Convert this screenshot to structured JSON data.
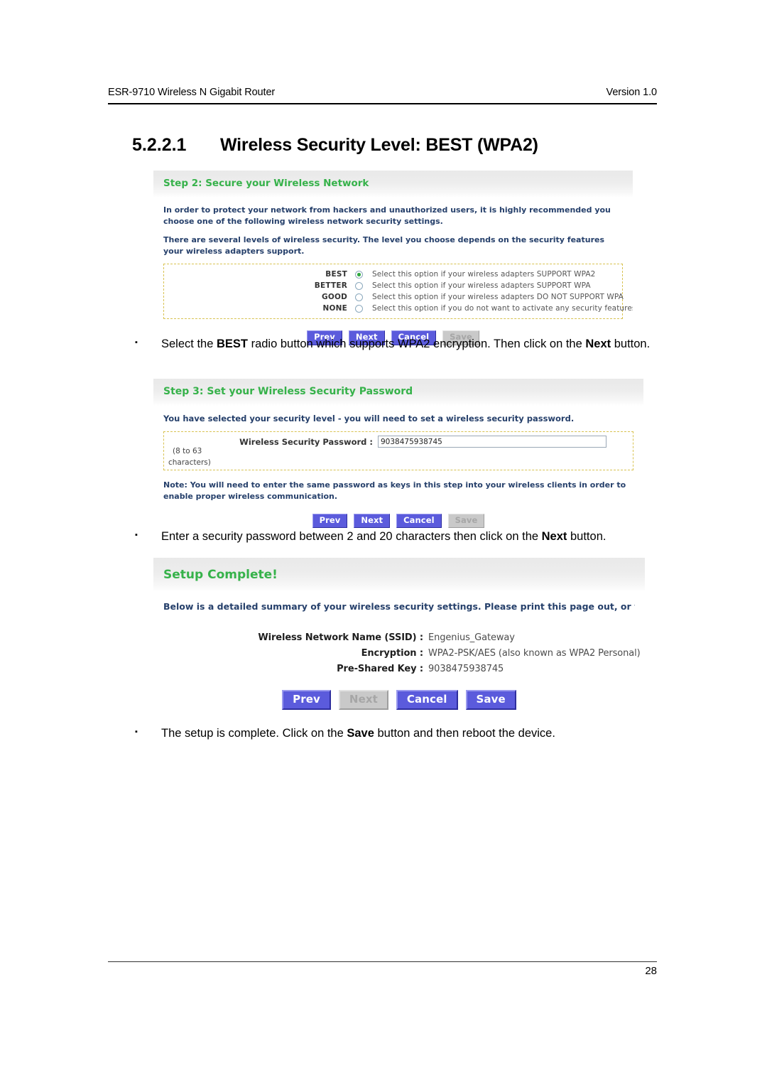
{
  "header": {
    "left": "ESR-9710 Wireless N Gigabit Router",
    "right": "Version 1.0"
  },
  "heading": {
    "number": "5.2.2.1",
    "title": "Wireless Security Level: BEST (WPA2)"
  },
  "step2": {
    "title": "Step 2: Secure your Wireless Network",
    "paragraph1": "In order to protect your network from hackers and unauthorized users, it is highly recommended you choose one of the following wireless network security settings.",
    "paragraph2": "There are several levels of wireless security. The level you choose depends on the security features your wireless adapters support.",
    "options": [
      {
        "label": "BEST",
        "desc": "Select this option if your wireless adapters SUPPORT WPA2",
        "selected": true
      },
      {
        "label": "BETTER",
        "desc": "Select this option if your wireless adapters SUPPORT WPA",
        "selected": false
      },
      {
        "label": "GOOD",
        "desc": "Select this option if your wireless adapters DO NOT SUPPORT WPA",
        "selected": false
      },
      {
        "label": "NONE",
        "desc": "Select this option if you do not want to activate any security features",
        "selected": false
      }
    ],
    "buttons": [
      {
        "label": "Prev",
        "disabled": false
      },
      {
        "label": "Next",
        "disabled": false
      },
      {
        "label": "Cancel",
        "disabled": false
      },
      {
        "label": "Save",
        "disabled": true
      }
    ]
  },
  "bullet1": {
    "mark": "▪",
    "parts": [
      {
        "text": "Select the ",
        "bold": false
      },
      {
        "text": "BEST",
        "bold": true
      },
      {
        "text": " radio button which supports WPA2 encryption. Then click on the ",
        "bold": false
      },
      {
        "text": "Next",
        "bold": true
      },
      {
        "text": " button.",
        "bold": false
      }
    ]
  },
  "step3": {
    "title": "Step 3: Set your Wireless Security Password",
    "paragraph1": "You have selected your security level - you will need to set a wireless security password.",
    "field": {
      "label": "Wireless Security Password :",
      "value": "9038475938745",
      "hint": "(8 to 63",
      "hint_wrap": "characters)"
    },
    "note": "Note: You will need to enter the same password as keys in this step into your wireless clients in order to enable proper wireless communication.",
    "buttons": [
      {
        "label": "Prev",
        "disabled": false
      },
      {
        "label": "Next",
        "disabled": false
      },
      {
        "label": "Cancel",
        "disabled": false
      },
      {
        "label": "Save",
        "disabled": true
      }
    ]
  },
  "bullet2": {
    "mark": "▪",
    "parts": [
      {
        "text": "Enter a security password between 2 and 20 characters then click on the ",
        "bold": false
      },
      {
        "text": "Next",
        "bold": true
      },
      {
        "text": " button.",
        "bold": false
      }
    ]
  },
  "complete": {
    "title": "Setup Complete!",
    "paragraph1": "Below is a detailed summary of your wireless security settings. Please print this page out, or write the inform can configure the correct settings on your wireless client adapters.",
    "summary": [
      {
        "label": "Wireless Network Name (SSID) :",
        "value": "Engenius_Gateway"
      },
      {
        "label": "Encryption :",
        "value": "WPA2-PSK/AES (also known as WPA2 Personal)"
      },
      {
        "label": "Pre-Shared Key :",
        "value": "9038475938745"
      }
    ],
    "buttons": [
      {
        "label": "Prev",
        "disabled": false
      },
      {
        "label": "Next",
        "disabled": true
      },
      {
        "label": "Cancel",
        "disabled": false
      },
      {
        "label": "Save",
        "disabled": false
      }
    ]
  },
  "bullet3": {
    "mark": "▪",
    "parts": [
      {
        "text": "The setup is complete. Click on the ",
        "bold": false
      },
      {
        "text": "Save",
        "bold": true
      },
      {
        "text": " button and then reboot the device.",
        "bold": false
      }
    ]
  },
  "footer": {
    "page_number": "28"
  },
  "colors": {
    "panel_title_green": "#36b24a",
    "panel_text_blue": "#26406b",
    "button_blue": "#5b5bdc",
    "radio_green": "#2fa83f",
    "dotted_border": "#d8c251"
  }
}
